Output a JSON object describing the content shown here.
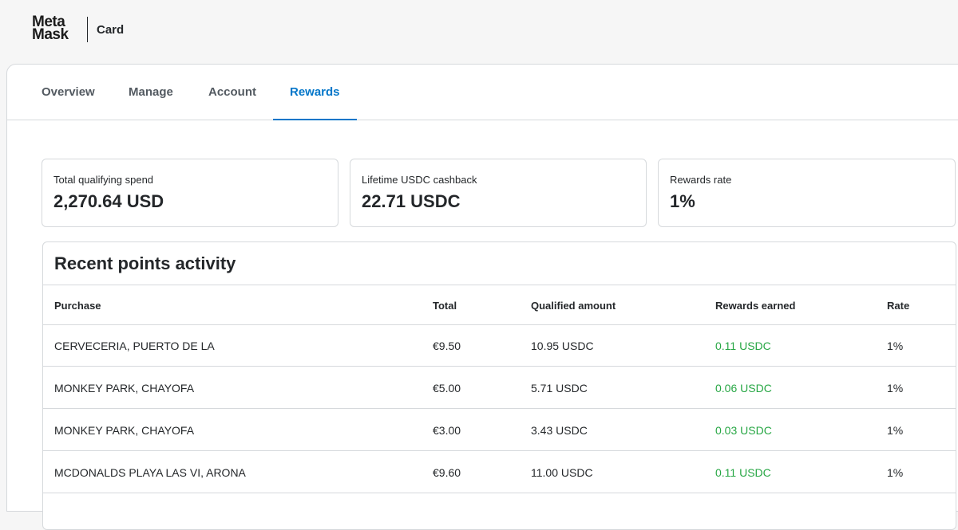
{
  "brand": {
    "logo_line1": "Meta",
    "logo_line2": "Mask",
    "product": "Card"
  },
  "tabs": [
    {
      "label": "Overview",
      "active": false
    },
    {
      "label": "Manage",
      "active": false
    },
    {
      "label": "Account",
      "active": false
    },
    {
      "label": "Rewards",
      "active": true
    }
  ],
  "stats": [
    {
      "label": "Total qualifying spend",
      "value": "2,270.64 USD"
    },
    {
      "label": "Lifetime USDC cashback",
      "value": "22.71 USDC"
    },
    {
      "label": "Rewards rate",
      "value": "1%"
    }
  ],
  "activity": {
    "title": "Recent points activity",
    "columns": [
      "Purchase",
      "Total",
      "Qualified amount",
      "Rewards earned",
      "Rate"
    ],
    "rows": [
      {
        "purchase": "CERVECERIA, PUERTO DE LA",
        "total": "€9.50",
        "qualified": "10.95 USDC",
        "earned": "0.11 USDC",
        "rate": "1%"
      },
      {
        "purchase": "MONKEY PARK, CHAYOFA",
        "total": "€5.00",
        "qualified": "5.71 USDC",
        "earned": "0.06 USDC",
        "rate": "1%"
      },
      {
        "purchase": "MONKEY PARK, CHAYOFA",
        "total": "€3.00",
        "qualified": "3.43 USDC",
        "earned": "0.03 USDC",
        "rate": "1%"
      },
      {
        "purchase": "MCDONALDS PLAYA LAS VI, ARONA",
        "total": "€9.60",
        "qualified": "11.00 USDC",
        "earned": "0.11 USDC",
        "rate": "1%"
      }
    ]
  },
  "colors": {
    "accent": "#0376c9",
    "reward_green": "#28a745",
    "border": "#d6d9dc"
  }
}
